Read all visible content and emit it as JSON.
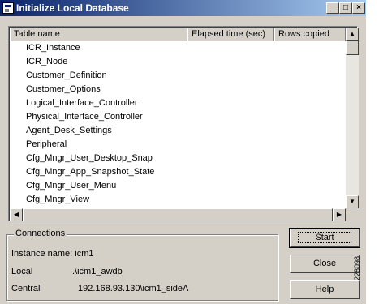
{
  "window": {
    "title": "Initialize Local Database"
  },
  "titlebar_buttons": {
    "minimize": "_",
    "maximize": "□",
    "close": "×"
  },
  "table": {
    "columns": [
      "Table name",
      "Elapsed time (sec)",
      "Rows copied"
    ],
    "rows": [
      "ICR_Instance",
      "ICR_Node",
      "Customer_Definition",
      "Customer_Options",
      "Logical_Interface_Controller",
      "Physical_Interface_Controller",
      "Agent_Desk_Settings",
      "Peripheral",
      "Cfg_Mngr_User_Desktop_Snap",
      "Cfg_Mngr_App_Snapshot_State",
      "Cfg_Mngr_User_Menu",
      "Cfg_Mngr_View"
    ]
  },
  "connections": {
    "title": "Connections",
    "instance_label": "Instance name: icm1",
    "local_label": "Local",
    "local_value": ".\\icm1_awdb",
    "central_label": "Central",
    "central_value": "192.168.93.130\\icm1_sideA"
  },
  "buttons": {
    "start": "Start",
    "close": "Close",
    "help": "Help"
  },
  "figure_id": "228098",
  "icons": [
    "app-icon",
    "minimize-icon",
    "maximize-icon",
    "close-icon",
    "scroll-up-icon",
    "scroll-down-icon",
    "scroll-left-icon",
    "scroll-right-icon"
  ]
}
